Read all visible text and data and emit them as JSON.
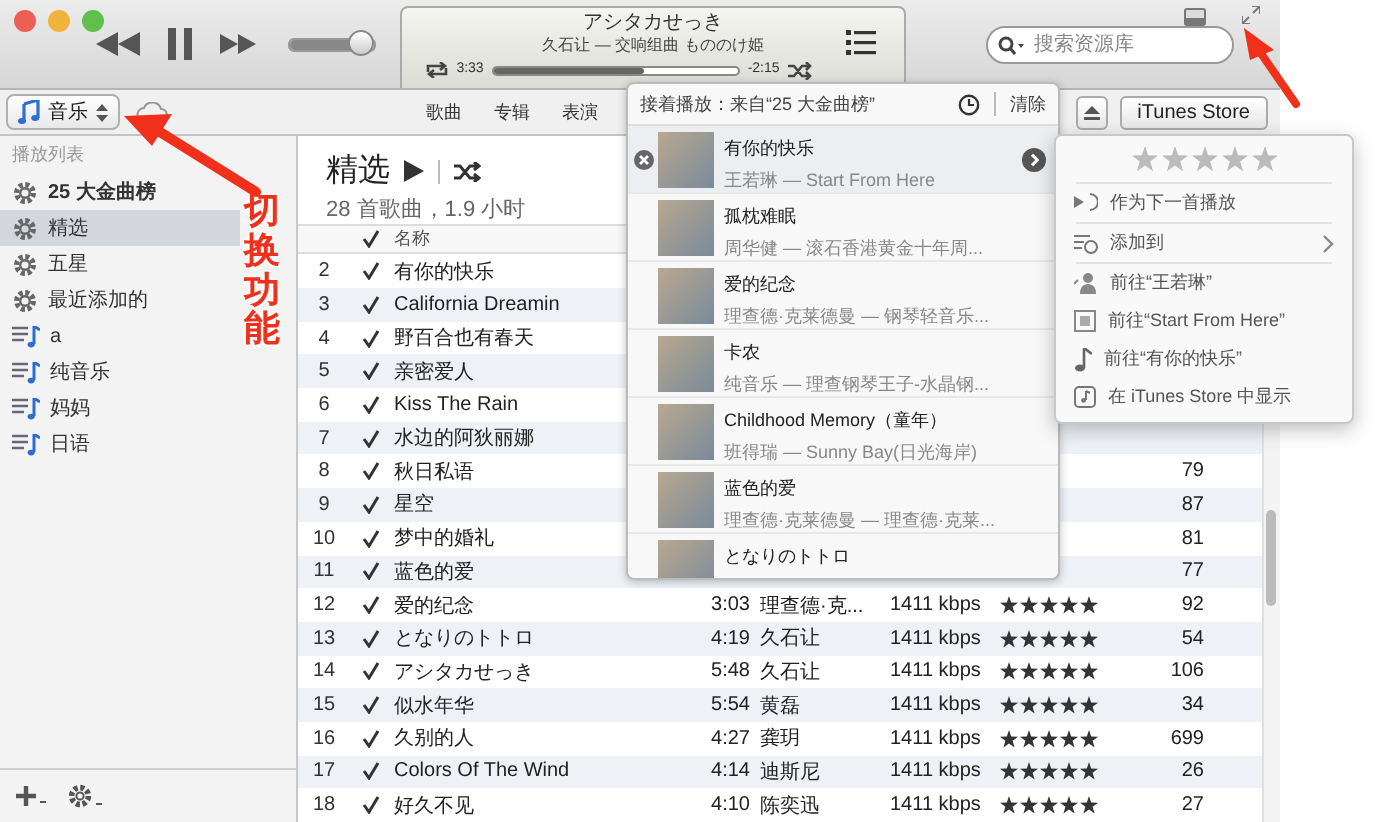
{
  "player": {
    "title": "アシタカせっき",
    "subtitle": "久石让 — 交响组曲 もののけ姫",
    "elapsed": "3:33",
    "remaining": "-2:15",
    "progress": {
      "level": 0.62
    },
    "volume": {
      "level": 0.85
    }
  },
  "search": {
    "placeholder": "搜索资源库"
  },
  "source": {
    "label": "音乐"
  },
  "tabs": [
    {
      "label": "歌曲",
      "selected": false
    },
    {
      "label": "专辑",
      "selected": false
    },
    {
      "label": "表演",
      "selected": false
    }
  ],
  "store_button": {
    "label": "iTunes Store"
  },
  "sidebar": {
    "header": "播放列表",
    "items": [
      {
        "label": "25 大金曲榜",
        "kind": "smart",
        "selected": false
      },
      {
        "label": "精选",
        "kind": "smart",
        "selected": true
      },
      {
        "label": "五星",
        "kind": "smart",
        "selected": false
      },
      {
        "label": "最近添加的",
        "kind": "smart",
        "selected": false
      },
      {
        "label": "a",
        "kind": "playlist",
        "selected": false
      },
      {
        "label": "纯音乐",
        "kind": "playlist",
        "selected": false
      },
      {
        "label": "妈妈",
        "kind": "playlist",
        "selected": false
      },
      {
        "label": "日语",
        "kind": "playlist",
        "selected": false
      }
    ]
  },
  "playlist": {
    "title": "精选",
    "summary": "28 首歌曲，1.9 小时"
  },
  "table": {
    "columns": [
      "名称"
    ],
    "rows": [
      {
        "number": "2",
        "checked": true,
        "name": "有你的快乐"
      },
      {
        "number": "3",
        "checked": true,
        "name": "California Dreamin"
      },
      {
        "number": "4",
        "checked": true,
        "name": "野百合也有春天"
      },
      {
        "number": "5",
        "checked": true,
        "name": "亲密爱人"
      },
      {
        "number": "6",
        "checked": true,
        "name": "Kiss The Rain"
      },
      {
        "number": "7",
        "checked": true,
        "name": "水边的阿狄丽娜"
      },
      {
        "number": "8",
        "checked": true,
        "name": "秋日私语",
        "plays": "79"
      },
      {
        "number": "9",
        "checked": true,
        "name": "星空",
        "plays": "87"
      },
      {
        "number": "10",
        "checked": true,
        "name": "梦中的婚礼",
        "plays": "81"
      },
      {
        "number": "11",
        "checked": true,
        "name": "蓝色的爱",
        "plays": "77"
      },
      {
        "number": "12",
        "checked": true,
        "name": "爱的纪念",
        "time": "3:03",
        "artist": "理查德·克...",
        "bitrate": "1411 kbps",
        "stars": 5,
        "plays": "92"
      },
      {
        "number": "13",
        "checked": true,
        "name": "となりのトトロ",
        "time": "4:19",
        "artist": "久石让",
        "bitrate": "1411 kbps",
        "stars": 5,
        "plays": "54"
      },
      {
        "number": "14",
        "checked": true,
        "name": "アシタカせっき",
        "time": "5:48",
        "artist": "久石让",
        "bitrate": "1411 kbps",
        "stars": 5,
        "plays": "106"
      },
      {
        "number": "15",
        "checked": true,
        "name": "似水年华",
        "time": "5:54",
        "artist": "黄磊",
        "bitrate": "1411 kbps",
        "stars": 5,
        "plays": "34"
      },
      {
        "number": "16",
        "checked": true,
        "name": "久别的人",
        "time": "4:27",
        "artist": "龚玥",
        "bitrate": "1411 kbps",
        "stars": 5,
        "plays": "699"
      },
      {
        "number": "17",
        "checked": true,
        "name": "Colors Of The Wind",
        "time": "4:14",
        "artist": "迪斯尼",
        "bitrate": "1411 kbps",
        "stars": 5,
        "plays": "26"
      },
      {
        "number": "18",
        "checked": true,
        "name": "好久不见",
        "time": "4:10",
        "artist": "陈奕迅",
        "bitrate": "1411 kbps",
        "stars": 5,
        "plays": "27"
      }
    ]
  },
  "up_next": {
    "header": "接着播放：来自“25 大金曲榜”",
    "clear": "清除",
    "items": [
      {
        "title": "有你的快乐",
        "subtitle": "王若琳 — Start From Here",
        "selected": true
      },
      {
        "title": "孤枕难眠",
        "subtitle": "周华健 — 滚石香港黄金十年周...",
        "selected": false
      },
      {
        "title": "爱的纪念",
        "subtitle": "理查德·克莱德曼 — 钢琴轻音乐...",
        "selected": false
      },
      {
        "title": "卡农",
        "subtitle": "纯音乐 — 理查钢琴王子-水晶钢...",
        "selected": false
      },
      {
        "title": "Childhood Memory（童年）",
        "subtitle": "班得瑞 — Sunny Bay(日光海岸)",
        "selected": false
      },
      {
        "title": "蓝色的爱",
        "subtitle": "理查德·克莱德曼 — 理查德·克莱...",
        "selected": false
      },
      {
        "title": "となりのトトロ",
        "selected": false
      }
    ]
  },
  "context_menu": {
    "rating": {
      "stars": 0
    },
    "items": [
      {
        "label": "作为下一首播放",
        "kind": "play-next",
        "submenu": false
      },
      {
        "label": "添加到",
        "kind": "add",
        "submenu": true
      },
      {
        "label": "前往“王若琳”",
        "kind": "artist",
        "submenu": false
      },
      {
        "label": "前往“Start From Here”",
        "kind": "album",
        "submenu": false
      },
      {
        "label": "前往“有你的快乐”",
        "kind": "song",
        "submenu": false
      },
      {
        "label": "在 iTunes Store 中显示",
        "kind": "store",
        "submenu": false
      }
    ]
  },
  "annotation": {
    "text": "切换功能"
  }
}
